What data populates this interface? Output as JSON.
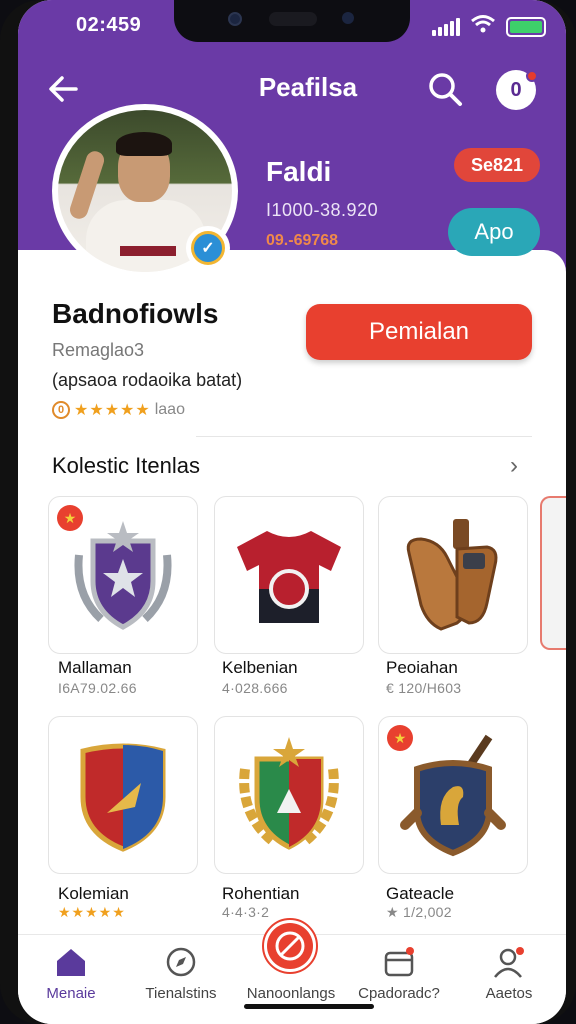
{
  "status_bar": {
    "time": "02:459"
  },
  "header": {
    "title": "Peafilsa",
    "notification_label": "0",
    "name": "Faldi",
    "user_id": "I1000-38.920",
    "coins": "09.-69768",
    "red_pill": "Se821",
    "teal_pill": "Apo"
  },
  "profile": {
    "title": "Badnofiowls",
    "subtitle": "Remaglao3",
    "description": "(apsaoa rodaoika batat)",
    "rating_coin": "0",
    "rating_stars": "★★★★★",
    "rating_text": "laao",
    "cta_label": "Pemialan"
  },
  "section": {
    "title": "Kolestic Itenlas",
    "arrow": "›"
  },
  "items": [
    {
      "name": "Mallaman",
      "meta": "I6A79.02.66",
      "tag": "★",
      "icon": "purple-shield-icon"
    },
    {
      "name": "Kelbenian",
      "meta": "4·028.666",
      "tag": "",
      "icon": "red-jersey-icon"
    },
    {
      "name": "Peoiahan",
      "meta": "€ 120/H603",
      "tag": "",
      "icon": "leather-gloves-icon"
    },
    {
      "name": "Kolemian",
      "meta": "★★★★★",
      "tag": "",
      "icon": "red-blue-shield-icon"
    },
    {
      "name": "Rohentian",
      "meta": "4·4·3·2",
      "tag": "",
      "icon": "laurel-crest-icon"
    },
    {
      "name": "Gateacle",
      "meta": "★ 1/2,002",
      "tag": "★",
      "icon": "knight-shield-icon"
    }
  ],
  "nav": [
    {
      "label": "Menaie",
      "icon": "home-icon"
    },
    {
      "label": "Tienalstins",
      "icon": "compass-icon"
    },
    {
      "label": "Nanoonlangs",
      "icon": "prohibit-icon"
    },
    {
      "label": "Cpadoradc?",
      "icon": "wallet-icon"
    },
    {
      "label": "Aaetos",
      "icon": "profile-icon"
    }
  ],
  "colors": {
    "brand": "#6a3aa6",
    "accent": "#e8402f",
    "teal": "#2aa7b7",
    "star": "#f0a01e"
  }
}
